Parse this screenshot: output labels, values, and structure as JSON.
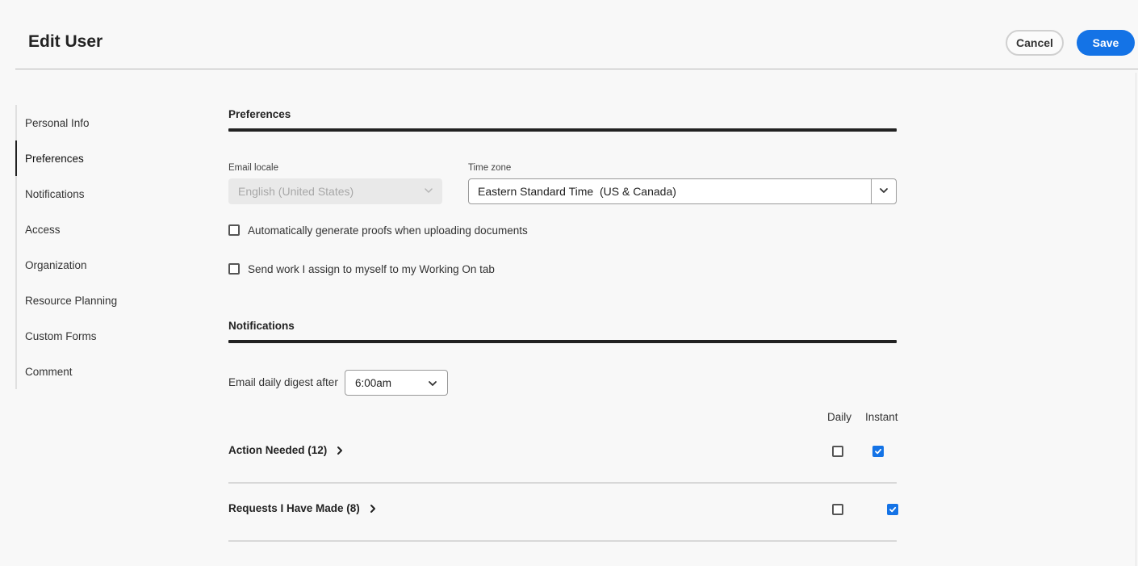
{
  "header": {
    "title": "Edit User",
    "cancel_label": "Cancel",
    "save_label": "Save"
  },
  "sidebar": {
    "items": [
      {
        "label": "Personal Info"
      },
      {
        "label": "Preferences",
        "active": true
      },
      {
        "label": "Notifications"
      },
      {
        "label": "Access"
      },
      {
        "label": "Organization"
      },
      {
        "label": "Resource Planning"
      },
      {
        "label": "Custom Forms"
      },
      {
        "label": "Comment"
      }
    ]
  },
  "preferences": {
    "title": "Preferences",
    "email_locale": {
      "label": "Email locale",
      "value": "English (United States)",
      "disabled": true
    },
    "time_zone": {
      "label": "Time zone",
      "value": "Eastern Standard Time  (US & Canada)"
    },
    "auto_proofs": {
      "label": "Automatically generate proofs when uploading documents",
      "checked": false
    },
    "send_work": {
      "label": "Send work I assign to myself to my Working On tab",
      "checked": false
    }
  },
  "notifications": {
    "title": "Notifications",
    "digest_label": "Email daily digest after",
    "digest_value": "6:00am",
    "columns": {
      "daily": "Daily",
      "instant": "Instant"
    },
    "rows": [
      {
        "label": "Action Needed (12)",
        "daily": false,
        "instant": true
      },
      {
        "label": "Requests I Have Made (8)",
        "daily": false,
        "instant": true
      }
    ]
  },
  "colors": {
    "accent": "#1473e6",
    "background": "#f8f8f8",
    "rule_dark": "#222222"
  },
  "icons": {
    "chevron_down": "chevron-down-icon",
    "chevron_right": "chevron-right-icon",
    "checkmark": "checkmark-icon"
  }
}
